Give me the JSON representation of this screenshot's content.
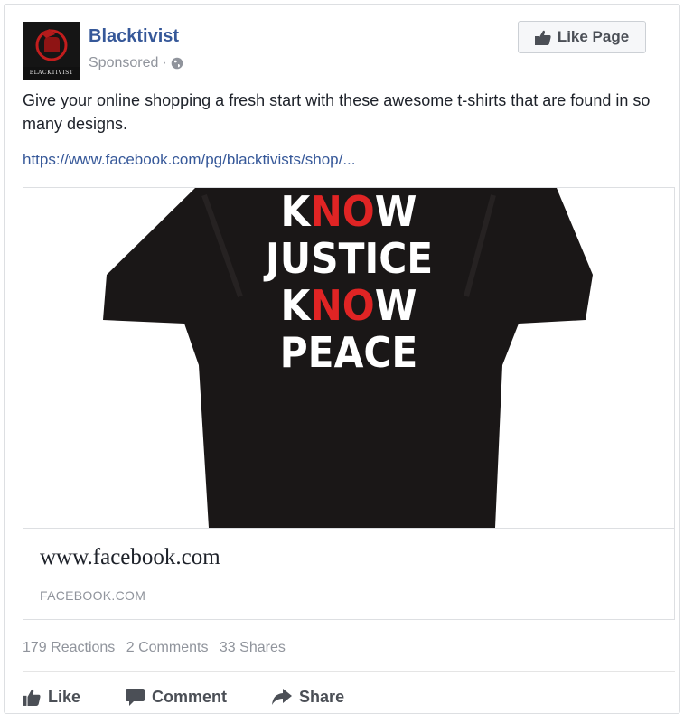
{
  "post": {
    "page_name": "Blacktivist",
    "avatar_caption": "BLACKTIVIST",
    "sponsored_label": "Sponsored",
    "separator": "·",
    "like_page_label": "Like Page",
    "body_text": "Give your online shopping a fresh start with these awesome t-shirts that are found in so many designs.",
    "link_text": "https://www.facebook.com/pg/blacktivists/shop/..."
  },
  "attachment": {
    "image": {
      "lines": [
        {
          "pre": "K",
          "red": "NO",
          "post": "W"
        },
        {
          "text": "JUSTICE"
        },
        {
          "pre": "K",
          "red": "NO",
          "post": "W"
        },
        {
          "text": "PEACE"
        }
      ],
      "shirt_color": "#1a1717",
      "accent_color": "#e02424"
    },
    "domain_title": "www.facebook.com",
    "domain_caption": "FACEBOOK.COM"
  },
  "engagement": {
    "reactions": "179 Reactions",
    "comments": "2 Comments",
    "shares": "33 Shares"
  },
  "actions": {
    "like": "Like",
    "comment": "Comment",
    "share": "Share"
  },
  "colors": {
    "link_blue": "#365899",
    "muted_gray": "#90949c",
    "button_text": "#4b4f56"
  },
  "icons": {
    "like_page": "thumbs-up-icon",
    "privacy": "globe-icon",
    "like": "thumbs-up-icon",
    "comment": "speech-bubble-icon",
    "share": "share-arrow-icon"
  }
}
